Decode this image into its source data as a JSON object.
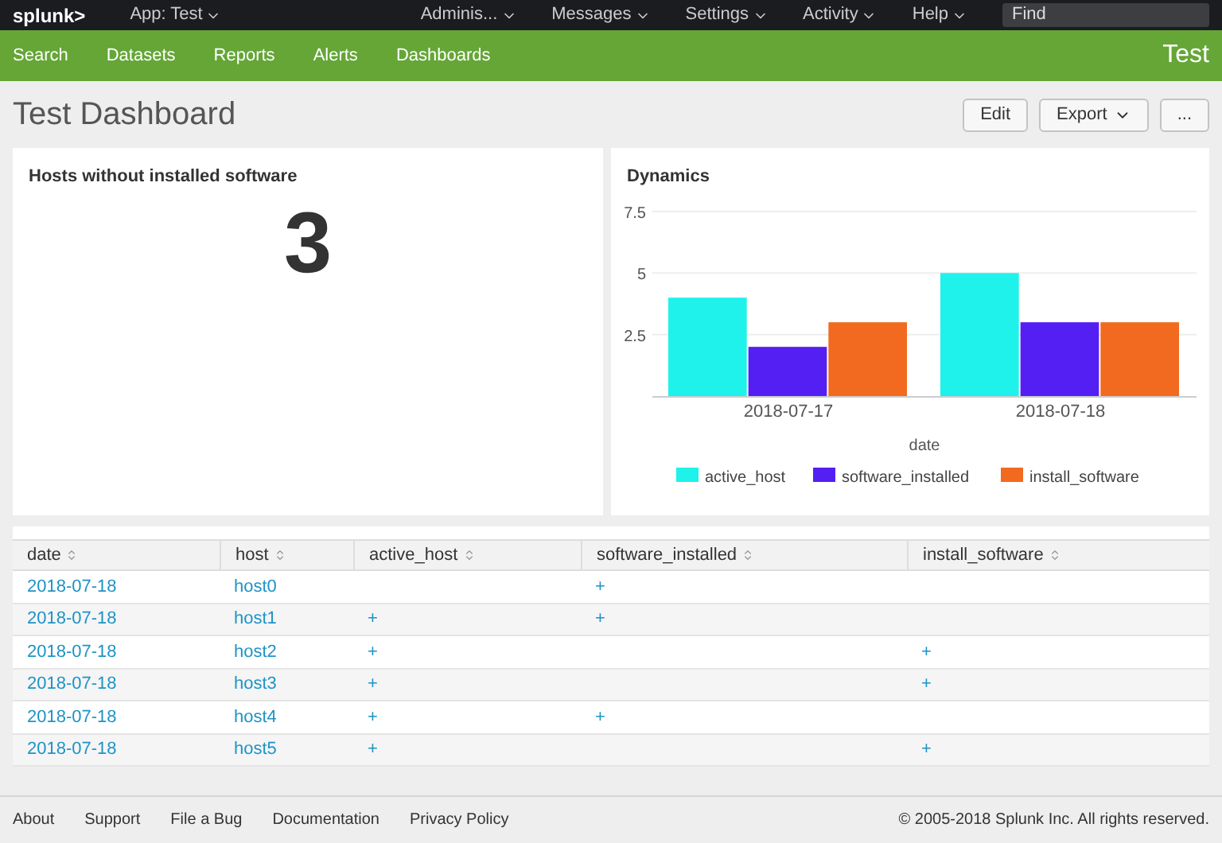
{
  "top_bar": {
    "logo": "splunk>",
    "app_menu": "App: Test",
    "menus": [
      "Adminis...",
      "Messages",
      "Settings",
      "Activity",
      "Help"
    ],
    "search": {
      "placeholder": "Find"
    }
  },
  "nav": {
    "items": [
      "Search",
      "Datasets",
      "Reports",
      "Alerts",
      "Dashboards"
    ],
    "app_title": "Test"
  },
  "dashboard": {
    "title": "Test Dashboard",
    "buttons": [
      {
        "label": "Edit",
        "kind": "plain"
      },
      {
        "label": "Export",
        "kind": "menu"
      },
      {
        "label": "...",
        "kind": "plain"
      }
    ]
  },
  "single_value": {
    "title": "Hosts without installed software",
    "value": "3"
  },
  "chart": {
    "title": "Dynamics",
    "chart_data": {
      "type": "bar",
      "legend": "bottom",
      "xlabel": "date",
      "categories": [
        "2018-07-17",
        "2018-07-18"
      ],
      "ylim": [
        0,
        7.5
      ],
      "yticks": [
        2.5,
        5,
        7.5
      ],
      "series": [
        {
          "name": "active_host",
          "color": "#1ef2eb",
          "values": [
            4,
            5
          ]
        },
        {
          "name": "software_installed",
          "color": "#541ff2",
          "values": [
            2,
            3
          ]
        },
        {
          "name": "install_software",
          "color": "#f26a1f",
          "values": [
            3,
            3
          ]
        }
      ]
    }
  },
  "table": {
    "columns": [
      "date",
      "host",
      "active_host",
      "software_installed",
      "install_software"
    ],
    "rows": [
      {
        "date": "2018-07-18",
        "host": "host0",
        "software_installed": "+"
      },
      {
        "date": "2018-07-18",
        "host": "host1",
        "active_host": "+",
        "software_installed": "+"
      },
      {
        "date": "2018-07-18",
        "host": "host2",
        "active_host": "+",
        "install_software": "+"
      },
      {
        "date": "2018-07-18",
        "host": "host3",
        "active_host": "+",
        "install_software": "+"
      },
      {
        "date": "2018-07-18",
        "host": "host4",
        "active_host": "+",
        "software_installed": "+"
      },
      {
        "date": "2018-07-18",
        "host": "host5",
        "active_host": "+",
        "install_software": "+"
      }
    ]
  },
  "footer": {
    "links": [
      "About",
      "Support",
      "File a Bug",
      "Documentation",
      "Privacy Policy"
    ],
    "copyright": "© 2005-2018 Splunk Inc. All rights reserved."
  }
}
